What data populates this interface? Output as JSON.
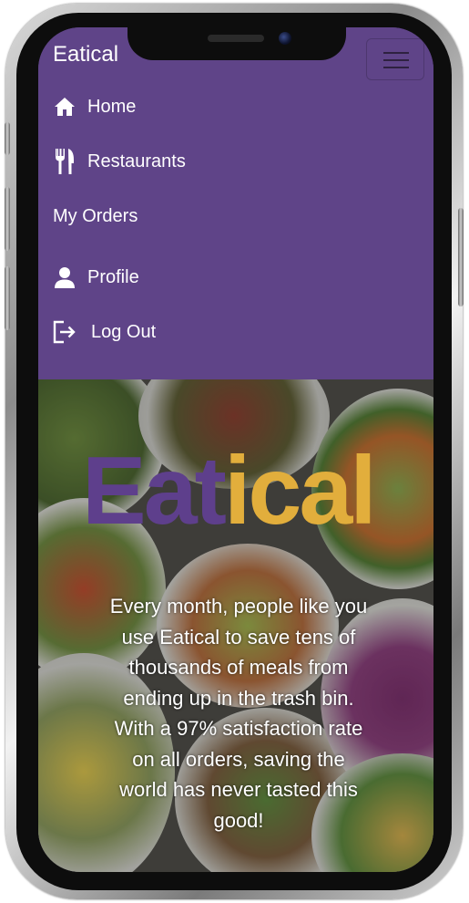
{
  "brand": "Eatical",
  "nav": {
    "items": [
      {
        "label": "Home",
        "icon": "home-icon"
      },
      {
        "label": "Restaurants",
        "icon": "fork-knife-icon"
      },
      {
        "label": "My Orders",
        "icon": ""
      },
      {
        "label": "Profile",
        "icon": "user-icon"
      },
      {
        "label": "Log Out",
        "icon": "logout-icon"
      }
    ],
    "toggler_icon": "hamburger-icon"
  },
  "hero": {
    "logo_part1": "Eat",
    "logo_part2": "ical",
    "tagline": "Every month, people like you use Eatical to save tens of thousands of meals from ending up in the trash bin. With a 97% satisfaction rate on all orders, saving the world has never tasted this good!"
  },
  "colors": {
    "nav_background": "#5f4488",
    "logo_purple": "#5e3f8c",
    "logo_gold": "#e2ae3c",
    "text": "#ffffff"
  }
}
